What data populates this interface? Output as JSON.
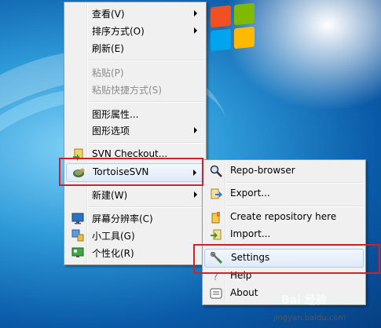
{
  "context_menu": {
    "items": [
      {
        "label": "查看(V)",
        "submenu": true
      },
      {
        "label": "排序方式(O)",
        "submenu": true
      },
      {
        "label": "刷新(E)"
      },
      {
        "label": "粘贴(P)",
        "disabled": true
      },
      {
        "label": "粘贴快捷方式(S)",
        "disabled": true
      },
      {
        "label": "图形属性..."
      },
      {
        "label": "图形选项",
        "submenu": true
      },
      {
        "label": "SVN Checkout...",
        "icon": "svn-checkout-icon"
      },
      {
        "label": "TortoiseSVN",
        "icon": "tortoisesvn-icon",
        "submenu": true,
        "highlighted": true
      },
      {
        "label": "新建(W)",
        "submenu": true
      },
      {
        "label": "屏幕分辨率(C)",
        "icon": "screen-resolution-icon"
      },
      {
        "label": "小工具(G)",
        "icon": "gadgets-icon"
      },
      {
        "label": "个性化(R)",
        "icon": "personalize-icon"
      }
    ]
  },
  "tortoise_submenu": {
    "items": [
      {
        "label": "Repo-browser",
        "icon": "repo-browser-icon"
      },
      {
        "label": "Export...",
        "icon": "export-icon"
      },
      {
        "label": "Create repository here",
        "icon": "create-repository-icon"
      },
      {
        "label": "Import...",
        "icon": "import-icon"
      },
      {
        "label": "Settings",
        "icon": "settings-icon",
        "highlighted": true
      },
      {
        "label": "Help",
        "icon": "help-icon"
      },
      {
        "label": "About",
        "icon": "about-icon"
      }
    ]
  },
  "watermark": {
    "brand": "Bai 经验",
    "url": "jingyan.baidu.com"
  },
  "colors": {
    "highlight_box": "#d0202a",
    "menu_bg": "#f0f0f0"
  }
}
